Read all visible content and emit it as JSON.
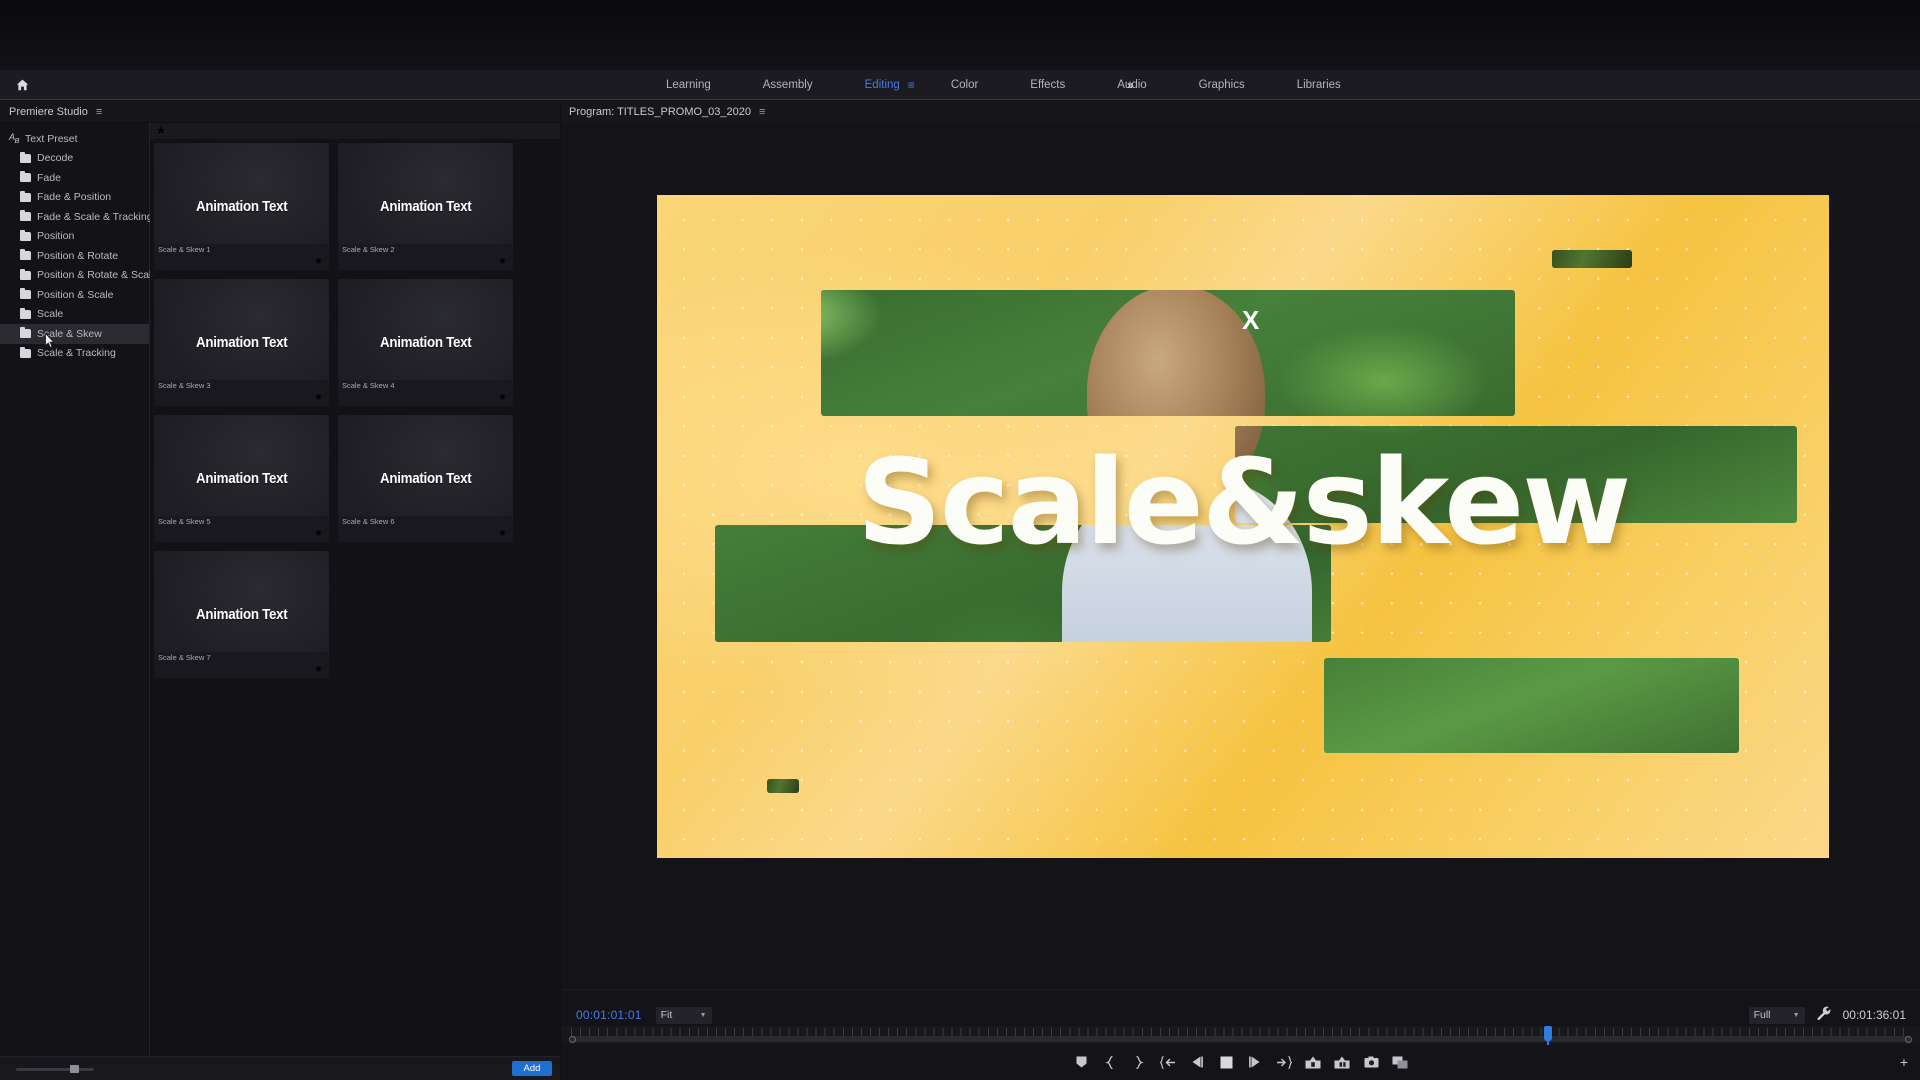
{
  "app": {
    "home_icon": "home-icon"
  },
  "workspaces": {
    "tabs": [
      {
        "label": "Learning",
        "active": false
      },
      {
        "label": "Assembly",
        "active": false
      },
      {
        "label": "Editing",
        "active": true
      },
      {
        "label": "Color",
        "active": false
      },
      {
        "label": "Effects",
        "active": false
      },
      {
        "label": "Audio",
        "active": false
      },
      {
        "label": "Graphics",
        "active": false
      },
      {
        "label": "Libraries",
        "active": false
      }
    ],
    "overflow_label": "»",
    "active_menu_icon": "hamburger-icon",
    "active_color": "#4a79e8"
  },
  "left_panel": {
    "title": "Premiere Studio",
    "menu_icon": "hamburger-icon",
    "tree": {
      "root_label": "Text Preset",
      "root_icon": "ab-text-icon",
      "items": [
        {
          "label": "Decode",
          "selected": false
        },
        {
          "label": "Fade",
          "selected": false
        },
        {
          "label": "Fade & Position",
          "selected": false
        },
        {
          "label": "Fade & Scale & Tracking",
          "selected": false
        },
        {
          "label": "Position",
          "selected": false
        },
        {
          "label": "Position & Rotate",
          "selected": false
        },
        {
          "label": "Position & Rotate & Scale",
          "selected": false
        },
        {
          "label": "Position & Scale",
          "selected": false
        },
        {
          "label": "Scale",
          "selected": false
        },
        {
          "label": "Scale & Skew",
          "selected": true
        },
        {
          "label": "Scale & Tracking",
          "selected": false
        }
      ]
    },
    "grid": {
      "header_star_icon": "star-icon",
      "preview_text": "Animation Text",
      "cards": [
        {
          "label": "Scale & Skew 1"
        },
        {
          "label": "Scale & Skew 2"
        },
        {
          "label": "Scale & Skew 3"
        },
        {
          "label": "Scale & Skew 4"
        },
        {
          "label": "Scale & Skew 5"
        },
        {
          "label": "Scale & Skew 6"
        },
        {
          "label": "Scale & Skew 7"
        }
      ]
    },
    "bottom": {
      "add_label": "Add",
      "add_color": "#1f6fd0",
      "zoom_slider_name": "thumbnail-size-slider"
    }
  },
  "program_monitor": {
    "title": "Program: TITLES_PROMO_03_2020",
    "menu_icon": "hamburger-icon",
    "video": {
      "title_text": "Scale&skew",
      "x_mark": "X",
      "background_color": "#f7c84e"
    },
    "transport": {
      "current_timecode": "00:01:01:01",
      "fit_label": "Fit",
      "quality_label": "Full",
      "settings_icon": "wrench-icon",
      "total_timecode": "00:01:36:01",
      "playhead_position_pct": 73,
      "buttons": [
        {
          "name": "add-marker-button",
          "icon": "marker-icon"
        },
        {
          "name": "mark-in-button",
          "icon": "brace-left-icon"
        },
        {
          "name": "mark-out-button",
          "icon": "brace-right-icon"
        },
        {
          "name": "go-to-in-button",
          "icon": "go-to-in-icon"
        },
        {
          "name": "step-back-button",
          "icon": "step-back-icon"
        },
        {
          "name": "play-stop-button",
          "icon": "stop-icon"
        },
        {
          "name": "step-forward-button",
          "icon": "step-forward-icon"
        },
        {
          "name": "go-to-out-button",
          "icon": "go-to-out-icon"
        },
        {
          "name": "lift-button",
          "icon": "lift-icon"
        },
        {
          "name": "extract-button",
          "icon": "extract-icon"
        },
        {
          "name": "export-frame-button",
          "icon": "camera-icon"
        },
        {
          "name": "comparison-view-button",
          "icon": "comparison-view-icon"
        }
      ],
      "plus_label": "+"
    }
  }
}
